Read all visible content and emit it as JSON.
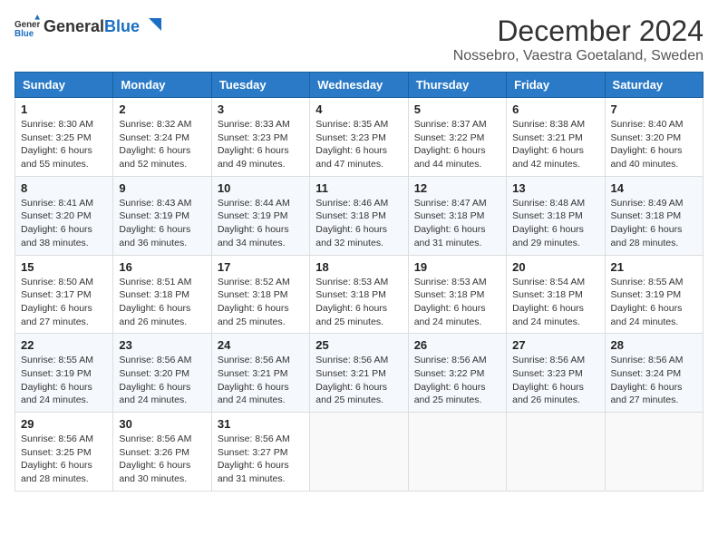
{
  "logo": {
    "text_general": "General",
    "text_blue": "Blue"
  },
  "title": "December 2024",
  "subtitle": "Nossebro, Vaestra Goetaland, Sweden",
  "days_of_week": [
    "Sunday",
    "Monday",
    "Tuesday",
    "Wednesday",
    "Thursday",
    "Friday",
    "Saturday"
  ],
  "weeks": [
    [
      {
        "day": "1",
        "sunrise": "8:30 AM",
        "sunset": "3:25 PM",
        "daylight": "6 hours and 55 minutes."
      },
      {
        "day": "2",
        "sunrise": "8:32 AM",
        "sunset": "3:24 PM",
        "daylight": "6 hours and 52 minutes."
      },
      {
        "day": "3",
        "sunrise": "8:33 AM",
        "sunset": "3:23 PM",
        "daylight": "6 hours and 49 minutes."
      },
      {
        "day": "4",
        "sunrise": "8:35 AM",
        "sunset": "3:23 PM",
        "daylight": "6 hours and 47 minutes."
      },
      {
        "day": "5",
        "sunrise": "8:37 AM",
        "sunset": "3:22 PM",
        "daylight": "6 hours and 44 minutes."
      },
      {
        "day": "6",
        "sunrise": "8:38 AM",
        "sunset": "3:21 PM",
        "daylight": "6 hours and 42 minutes."
      },
      {
        "day": "7",
        "sunrise": "8:40 AM",
        "sunset": "3:20 PM",
        "daylight": "6 hours and 40 minutes."
      }
    ],
    [
      {
        "day": "8",
        "sunrise": "8:41 AM",
        "sunset": "3:20 PM",
        "daylight": "6 hours and 38 minutes."
      },
      {
        "day": "9",
        "sunrise": "8:43 AM",
        "sunset": "3:19 PM",
        "daylight": "6 hours and 36 minutes."
      },
      {
        "day": "10",
        "sunrise": "8:44 AM",
        "sunset": "3:19 PM",
        "daylight": "6 hours and 34 minutes."
      },
      {
        "day": "11",
        "sunrise": "8:46 AM",
        "sunset": "3:18 PM",
        "daylight": "6 hours and 32 minutes."
      },
      {
        "day": "12",
        "sunrise": "8:47 AM",
        "sunset": "3:18 PM",
        "daylight": "6 hours and 31 minutes."
      },
      {
        "day": "13",
        "sunrise": "8:48 AM",
        "sunset": "3:18 PM",
        "daylight": "6 hours and 29 minutes."
      },
      {
        "day": "14",
        "sunrise": "8:49 AM",
        "sunset": "3:18 PM",
        "daylight": "6 hours and 28 minutes."
      }
    ],
    [
      {
        "day": "15",
        "sunrise": "8:50 AM",
        "sunset": "3:17 PM",
        "daylight": "6 hours and 27 minutes."
      },
      {
        "day": "16",
        "sunrise": "8:51 AM",
        "sunset": "3:18 PM",
        "daylight": "6 hours and 26 minutes."
      },
      {
        "day": "17",
        "sunrise": "8:52 AM",
        "sunset": "3:18 PM",
        "daylight": "6 hours and 25 minutes."
      },
      {
        "day": "18",
        "sunrise": "8:53 AM",
        "sunset": "3:18 PM",
        "daylight": "6 hours and 25 minutes."
      },
      {
        "day": "19",
        "sunrise": "8:53 AM",
        "sunset": "3:18 PM",
        "daylight": "6 hours and 24 minutes."
      },
      {
        "day": "20",
        "sunrise": "8:54 AM",
        "sunset": "3:18 PM",
        "daylight": "6 hours and 24 minutes."
      },
      {
        "day": "21",
        "sunrise": "8:55 AM",
        "sunset": "3:19 PM",
        "daylight": "6 hours and 24 minutes."
      }
    ],
    [
      {
        "day": "22",
        "sunrise": "8:55 AM",
        "sunset": "3:19 PM",
        "daylight": "6 hours and 24 minutes."
      },
      {
        "day": "23",
        "sunrise": "8:56 AM",
        "sunset": "3:20 PM",
        "daylight": "6 hours and 24 minutes."
      },
      {
        "day": "24",
        "sunrise": "8:56 AM",
        "sunset": "3:21 PM",
        "daylight": "6 hours and 24 minutes."
      },
      {
        "day": "25",
        "sunrise": "8:56 AM",
        "sunset": "3:21 PM",
        "daylight": "6 hours and 25 minutes."
      },
      {
        "day": "26",
        "sunrise": "8:56 AM",
        "sunset": "3:22 PM",
        "daylight": "6 hours and 25 minutes."
      },
      {
        "day": "27",
        "sunrise": "8:56 AM",
        "sunset": "3:23 PM",
        "daylight": "6 hours and 26 minutes."
      },
      {
        "day": "28",
        "sunrise": "8:56 AM",
        "sunset": "3:24 PM",
        "daylight": "6 hours and 27 minutes."
      }
    ],
    [
      {
        "day": "29",
        "sunrise": "8:56 AM",
        "sunset": "3:25 PM",
        "daylight": "6 hours and 28 minutes."
      },
      {
        "day": "30",
        "sunrise": "8:56 AM",
        "sunset": "3:26 PM",
        "daylight": "6 hours and 30 minutes."
      },
      {
        "day": "31",
        "sunrise": "8:56 AM",
        "sunset": "3:27 PM",
        "daylight": "6 hours and 31 minutes."
      },
      null,
      null,
      null,
      null
    ]
  ],
  "labels": {
    "sunrise": "Sunrise:",
    "sunset": "Sunset:",
    "daylight": "Daylight:"
  }
}
